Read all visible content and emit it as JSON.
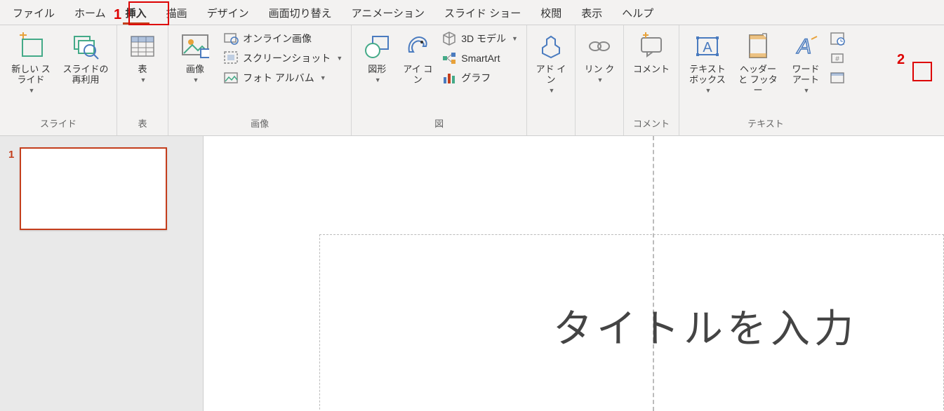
{
  "tabs": [
    "ファイル",
    "ホーム",
    "挿入",
    "描画",
    "デザイン",
    "画面切り替え",
    "アニメーション",
    "スライド ショー",
    "校閲",
    "表示",
    "ヘルプ"
  ],
  "active_tab": 2,
  "groups": {
    "slide": {
      "label": "スライド",
      "new_slide": "新しい\nスライド",
      "reuse": "スライドの\n再利用"
    },
    "table": {
      "label": "表",
      "table": "表"
    },
    "image": {
      "label": "画像",
      "image": "画像",
      "online": "オンライン画像",
      "screenshot": "スクリーンショット",
      "album": "フォト アルバム"
    },
    "illust": {
      "label": "図",
      "shapes": "図形",
      "icons": "アイ\nコン",
      "model3d": "3D モデル",
      "smartart": "SmartArt",
      "chart": "グラフ"
    },
    "addin": {
      "label": "",
      "addin": "アド\nイン"
    },
    "link": {
      "label": "",
      "link": "リン\nク"
    },
    "comment": {
      "label": "コメント",
      "comment": "コメント"
    },
    "text": {
      "label": "テキスト",
      "textbox": "テキスト\nボックス",
      "header": "ヘッダーと\nフッター",
      "wordart": "ワード\nアート"
    }
  },
  "thumb_num": "1",
  "slide_title": "タイトルを入力",
  "annotations": {
    "a1": "1",
    "a2": "2"
  }
}
